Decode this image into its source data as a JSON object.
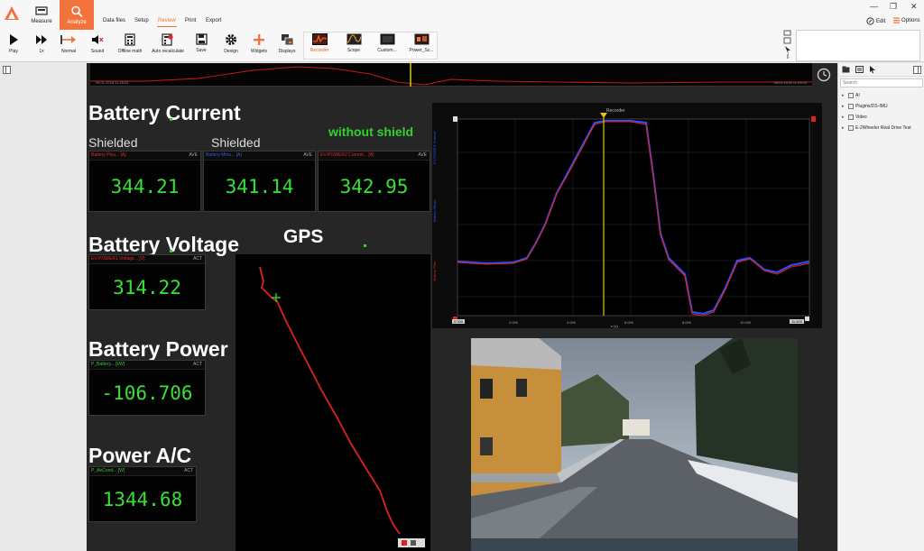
{
  "ribbon": {
    "tabs": {
      "measure": "Measure",
      "analyze": "Analyze",
      "data_files": "Data files",
      "setup": "Setup",
      "review": "Review",
      "print": "Print",
      "export": "Export"
    },
    "edit": "Edit",
    "options": "Options"
  },
  "toolbar": {
    "play": "Play",
    "speed": "1x",
    "normal": "Normal",
    "sound": "Sound",
    "offline_math": "Offline math",
    "auto_recalculate": "Auto recalculate",
    "save": "Save",
    "design": "Design",
    "widgets": "Widgets",
    "displays": "Displays",
    "recorder": "Recorder",
    "scope": "Scope",
    "custom": "Custom...",
    "power_sc": "Power_Sc..."
  },
  "display": {
    "overview": {
      "start_time": "08.01.2018 11:28:52",
      "end_time": "08.01.2018 11:29:03"
    },
    "battery_current": {
      "title": "Battery Current",
      "shielded_1": "Shielded",
      "shielded_2": "Shielded",
      "without_shield": "without shield",
      "meters": [
        {
          "name": "Battery Plus... [A]",
          "tag": "AVE",
          "value": "344.21"
        },
        {
          "name": "Battery Minu... [A]",
          "tag": "AVE",
          "value": "341.14"
        },
        {
          "name": "EV-POWER2 Current... [A]",
          "tag": "AVE",
          "value": "342.95"
        }
      ]
    },
    "battery_voltage": {
      "title": "Battery Voltage",
      "meter": {
        "name": "EV-POWER1 Voltage... [V]",
        "tag": "ACT",
        "value": "314.22"
      }
    },
    "gps": {
      "title": "GPS"
    },
    "battery_power": {
      "title": "Battery Power",
      "meter": {
        "name": "P_Battery... [kW]",
        "tag": "ACT",
        "value": "-106.706"
      }
    },
    "power_ac": {
      "title": "Power A/C",
      "meter": {
        "name": "P_AirCond... [W]",
        "tag": "ACT",
        "value": "1344.68"
      }
    },
    "recorder": {
      "cursor_label": "Recorder",
      "x_min": "0.000",
      "x_max": "11.500",
      "x_unit": "s (s)",
      "x_ticks": [
        "2.000",
        "4.000",
        "6.000",
        "8.000",
        "10.000"
      ],
      "y_labels": [
        "EV-POWER Current",
        "Battery Minus",
        "Battery Plus"
      ]
    }
  },
  "sidebar": {
    "search_placeholder": "Search",
    "tree": [
      "AI",
      "Plugins/DS-IMU",
      "Video",
      "E-2Wheeler Real Drive Test"
    ]
  },
  "colors": {
    "accent": "#f2743c",
    "meter_value": "#38e038",
    "trace_red": "#e02020",
    "trace_blue": "#2a4bff",
    "cursor": "#d8c81a"
  }
}
